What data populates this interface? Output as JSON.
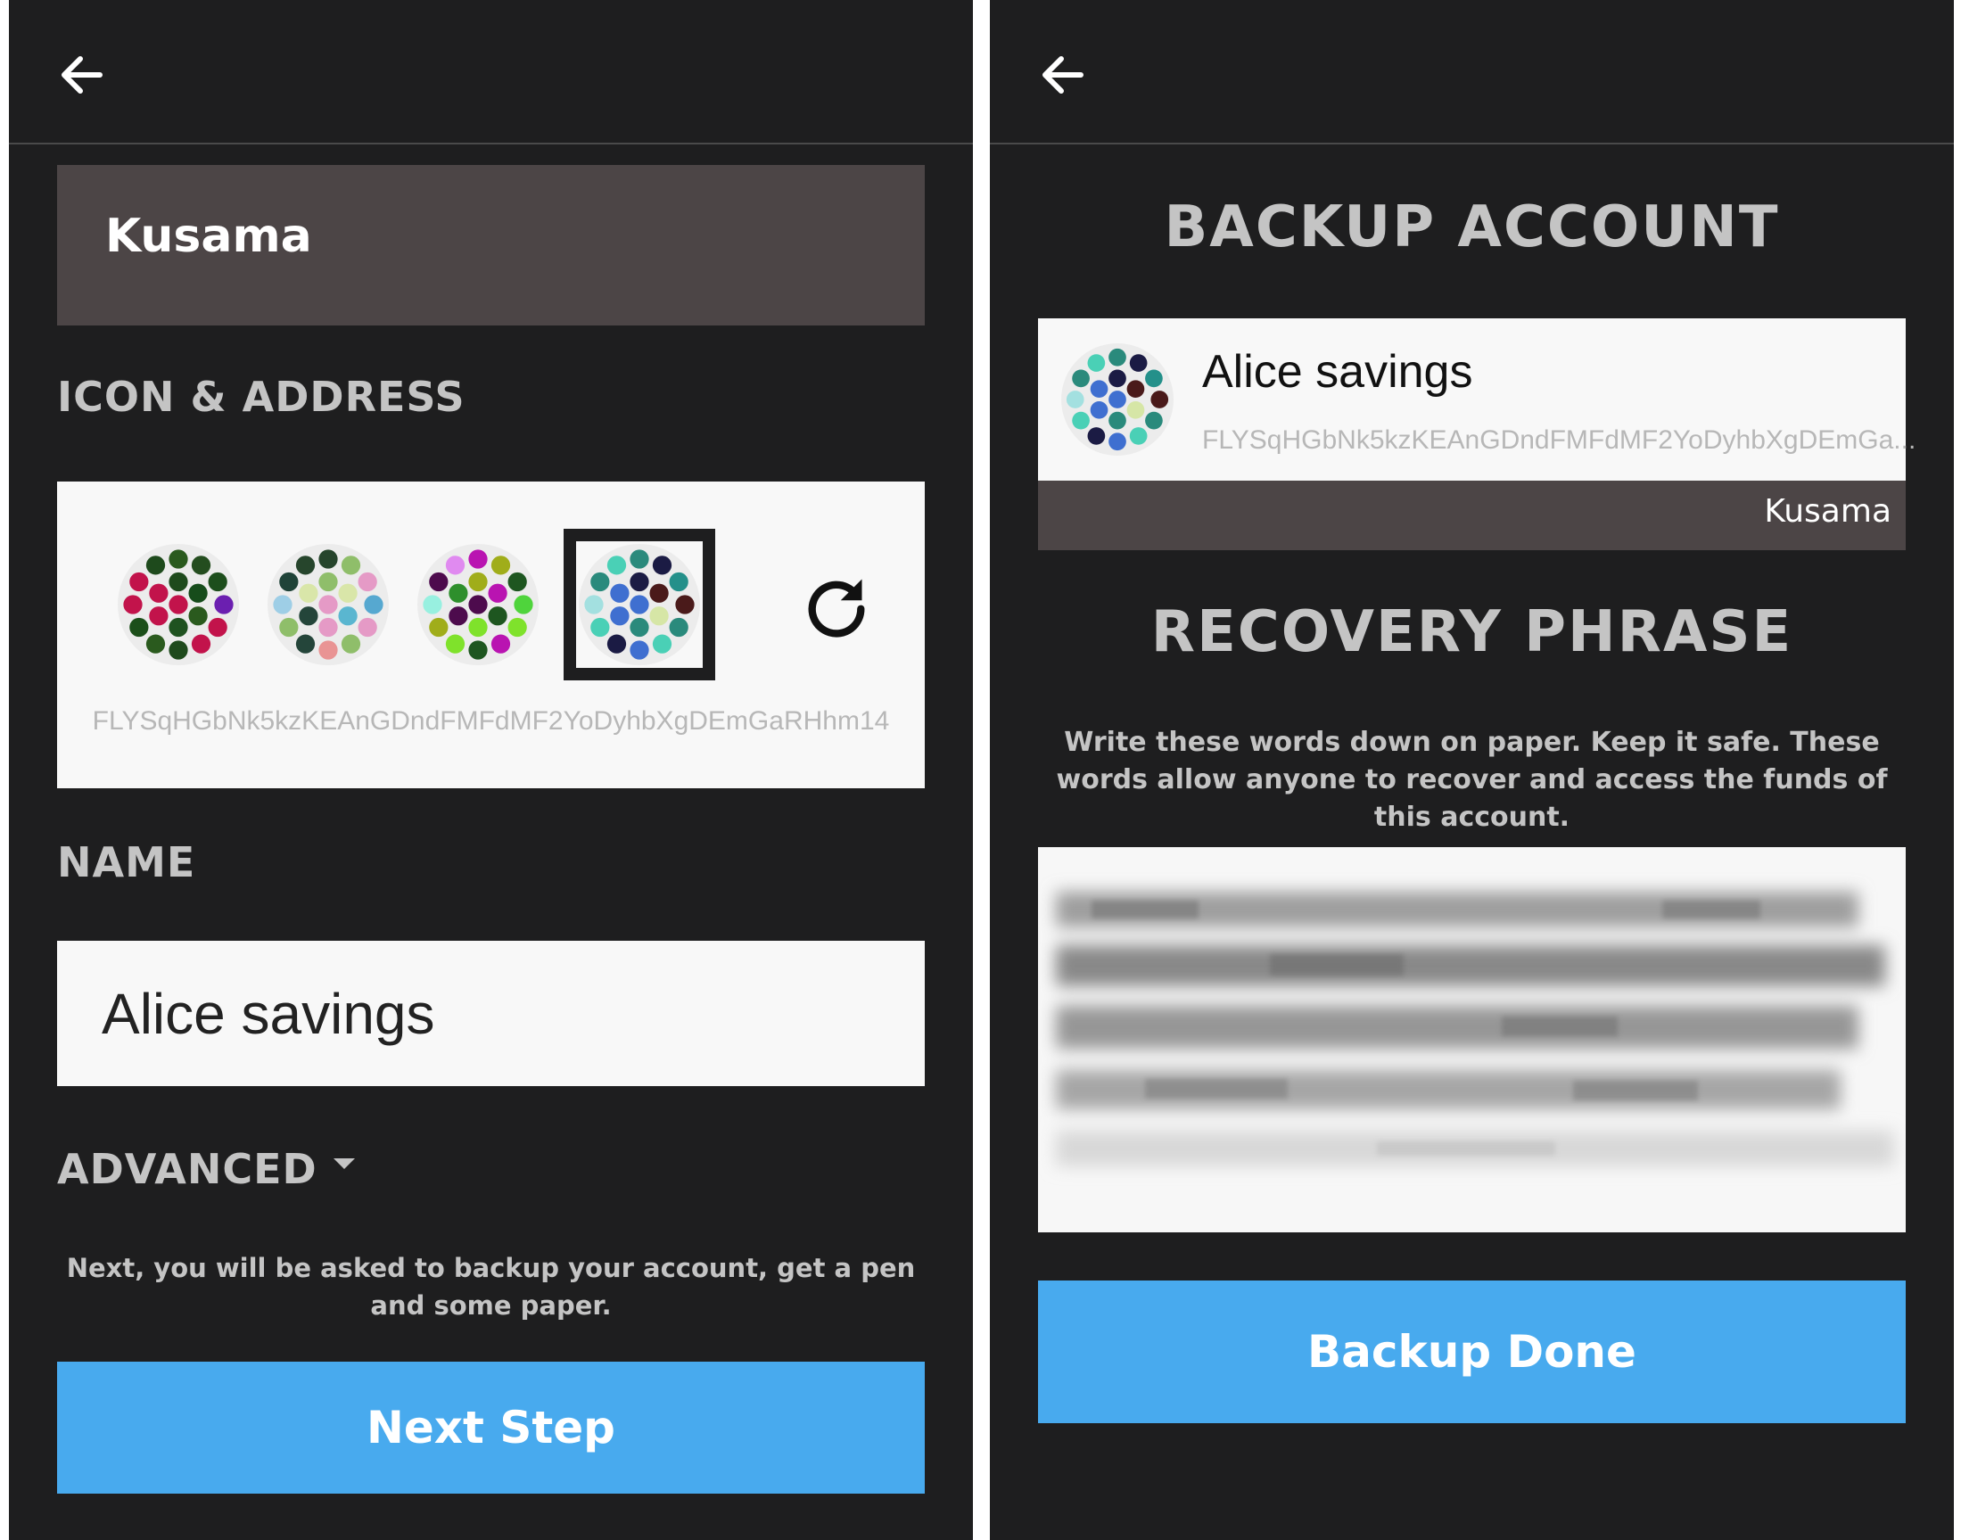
{
  "left_screen": {
    "back_icon": "arrow-left-icon",
    "network": "Kusama",
    "icon_section_title": "ICON & ADDRESS",
    "identicons": [
      {
        "id": "identicon-1",
        "selected": false,
        "colors": [
          "#c2134b",
          "#1e4a1c",
          "#164c1b",
          "#2a5a1e",
          "#1f5220",
          "#c2134b",
          "#c2134b",
          "#2a5a1e",
          "#244d1f",
          "#1d4e1c",
          "#6b1fb0",
          "#c2134b",
          "#c2134b",
          "#1e4a1c",
          "#2a5a1e",
          "#1c4f1a",
          "#c2134b",
          "#c2134b",
          "#1e4a1c"
        ]
      },
      {
        "id": "identicon-2",
        "selected": false,
        "colors": [
          "#e59ac6",
          "#8fbe6a",
          "#d9e6a9",
          "#5ab6d0",
          "#e59ac6",
          "#24453a",
          "#d9e6a9",
          "#26452c",
          "#8fbe6a",
          "#e59ac6",
          "#56a8d0",
          "#e59ac6",
          "#8fbe6a",
          "#e99494",
          "#24453a",
          "#8fbe6a",
          "#9ecee6",
          "#1f4338",
          "#26452c"
        ]
      },
      {
        "id": "identicon-3",
        "selected": false,
        "colors": [
          "#4d0b4d",
          "#a0ad1a",
          "#b914b1",
          "#1e5620",
          "#7fe22b",
          "#4d0b4d",
          "#2e8f2c",
          "#b914b1",
          "#a0ad1a",
          "#1e5620",
          "#4fd43c",
          "#7fe22b",
          "#b914b1",
          "#1e5620",
          "#7fe22b",
          "#a0ad1a",
          "#98f0e0",
          "#4d0b4d",
          "#e08af0"
        ]
      },
      {
        "id": "identicon-4",
        "selected": true,
        "colors": [
          "#3f6fd0",
          "#1b1b44",
          "#4a1a1a",
          "#d6e6a6",
          "#2a8a7c",
          "#3f6fd0",
          "#3f6fd0",
          "#2a8a7c",
          "#1b1b44",
          "#24908a",
          "#4a1a1a",
          "#2a8a7c",
          "#4ad0b6",
          "#3f6fd0",
          "#1b1b44",
          "#4ad0b6",
          "#a3e0e0",
          "#2a8a7c",
          "#4ad0b6"
        ]
      }
    ],
    "refresh_icon": "refresh-icon",
    "address": "FLYSqHGbNk5kzKEAnGDndFMFdMF2YoDyhbXgDEmGaRHhm14",
    "name_section_title": "NAME",
    "name_value": "Alice savings",
    "advanced_label": "ADVANCED",
    "advanced_icon": "caret-down-icon",
    "info_text": "Next, you will be asked to backup your account, get a pen and some paper.",
    "next_button": "Next Step",
    "accent": "#48aaee"
  },
  "right_screen": {
    "back_icon": "arrow-left-icon",
    "title": "BACKUP ACCOUNT",
    "account": {
      "name": "Alice savings",
      "address": "FLYSqHGbNk5kzKEAnGDndFMFdMF2YoDyhbXgDEmGa...",
      "network": "Kusama",
      "identicon_colors": [
        "#3f6fd0",
        "#1b1b44",
        "#4a1a1a",
        "#d6e6a6",
        "#2a8a7c",
        "#3f6fd0",
        "#3f6fd0",
        "#2a8a7c",
        "#1b1b44",
        "#24908a",
        "#4a1a1a",
        "#2a8a7c",
        "#4ad0b6",
        "#3f6fd0",
        "#1b1b44",
        "#4ad0b6",
        "#a3e0e0",
        "#2a8a7c",
        "#4ad0b6"
      ]
    },
    "recovery_title": "RECOVERY PHRASE",
    "recovery_info": "Write these words down on paper. Keep it safe. These words allow anyone to recover and access the funds of this account.",
    "backup_button": "Backup Done"
  }
}
